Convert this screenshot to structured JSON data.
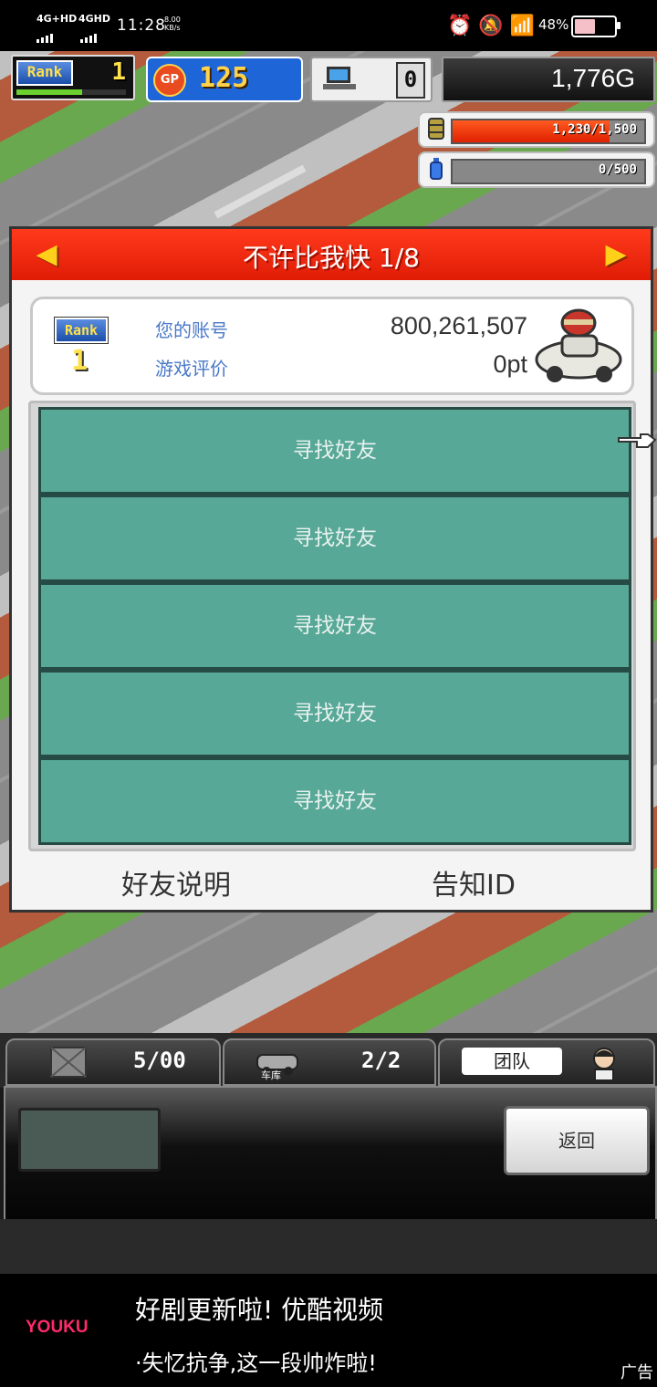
{
  "status_bar": {
    "net1": "4G+HD",
    "net2": "4GHD",
    "time": "11:28",
    "speed_value": "8.00",
    "speed_unit": "KB/s",
    "battery_text": "48%",
    "battery_level": 0.48
  },
  "hud": {
    "rank_label": "Rank",
    "rank_value": "1",
    "rank_progress": 0.6,
    "gp_label": "GP",
    "gp_value": "125",
    "pc_value": "0",
    "money": "1,776G"
  },
  "resources": {
    "fuel_text": "1,230/1,500",
    "fuel_level": 0.82,
    "bottle_text": "0/500",
    "bottle_level": 0
  },
  "dialog": {
    "title": "不许比我快 1/8",
    "rank_label": "Rank",
    "rank_value": "1",
    "account_label": "您的账号",
    "account_value": "800,261,507",
    "rating_label": "游戏评价",
    "rating_value": "0pt",
    "friend_slots": [
      "寻找好友",
      "寻找好友",
      "寻找好友",
      "寻找好友",
      "寻找好友"
    ],
    "friend_help": "好友说明",
    "notify_id": "告知ID"
  },
  "bottom": {
    "tab1_value": "5/00",
    "tab2_label": "车库",
    "tab2_value": "2/2",
    "tab3_label": "团队",
    "back_button": "返回"
  },
  "ad": {
    "brand": "YOUKU",
    "line1": "好剧更新啦! 优酷视频",
    "line2": "·失忆抗争,这一段帅炸啦!",
    "tag": "广告"
  }
}
